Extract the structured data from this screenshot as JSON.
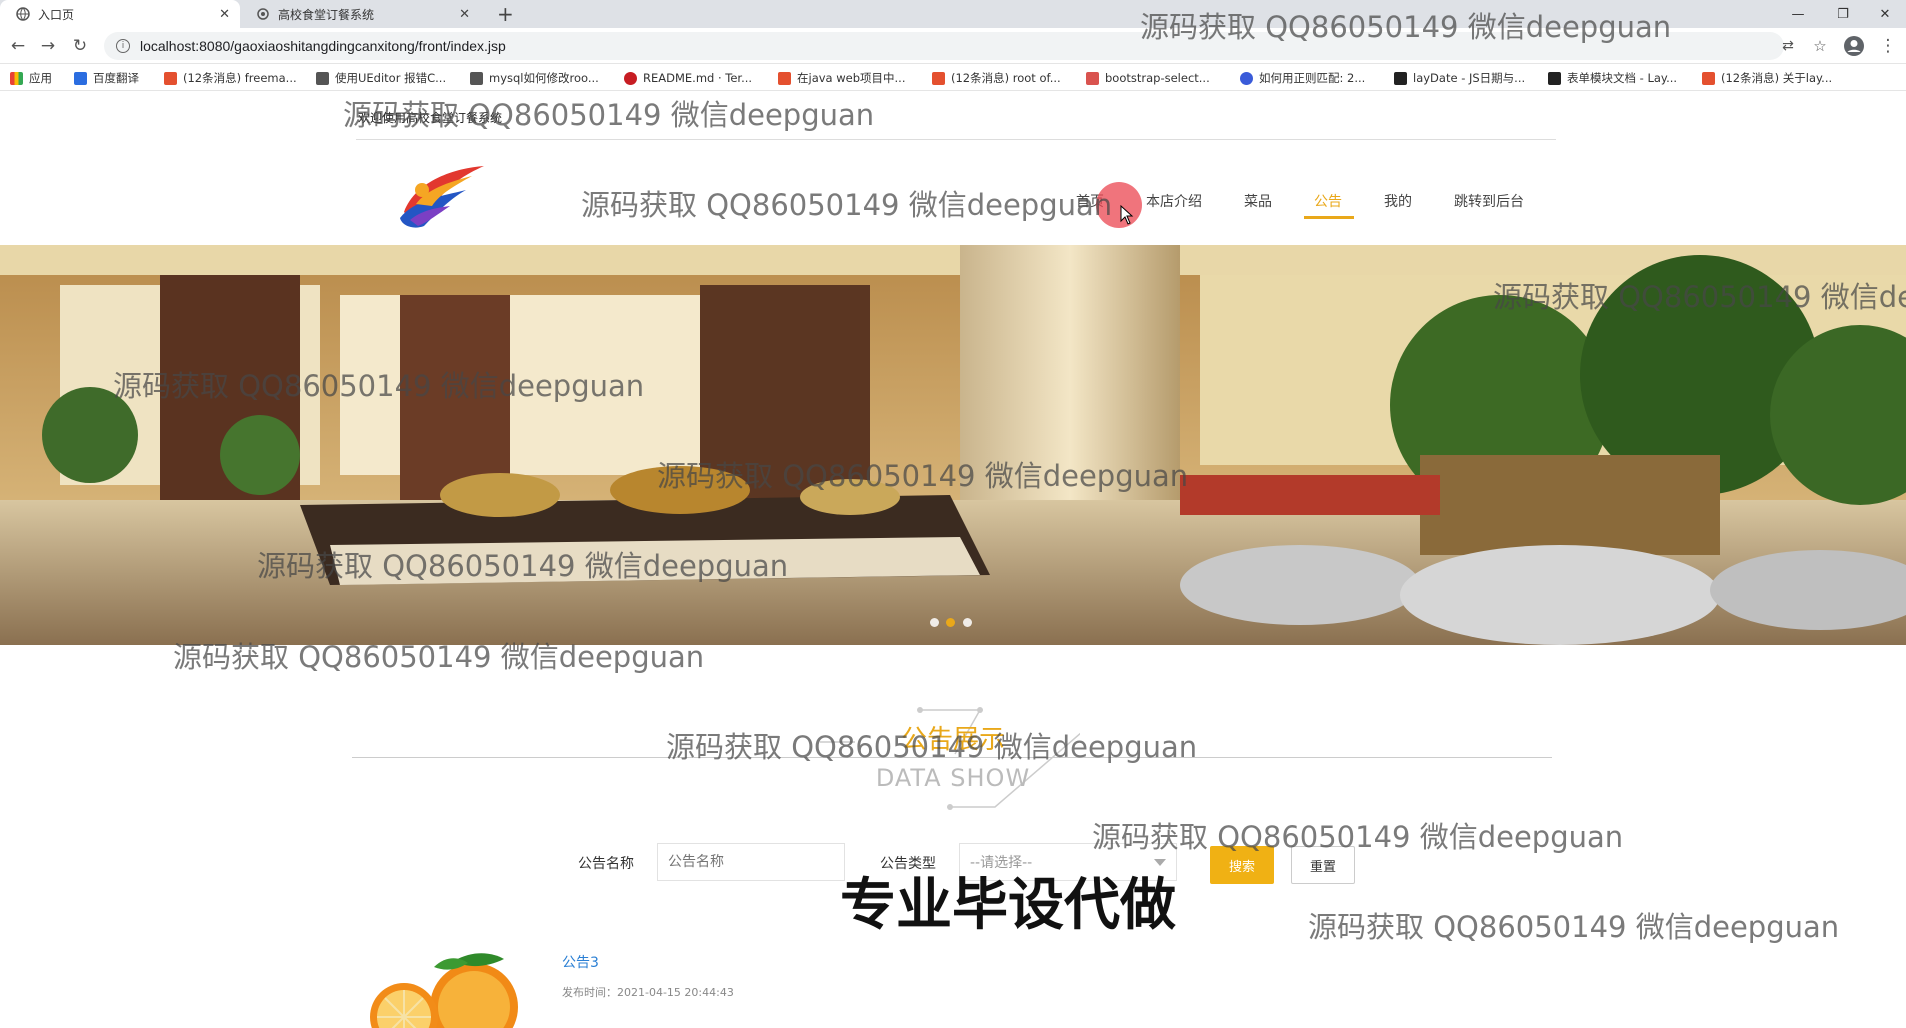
{
  "browser": {
    "tabs": [
      {
        "title": "入口页",
        "active": true
      },
      {
        "title": "高校食堂订餐系统",
        "active": false
      }
    ],
    "new_tab_label": "+",
    "url": "localhost:8080/gaoxiaoshitangdingcanxitong/front/index.jsp",
    "bookmarks": [
      "应用",
      "百度翻译",
      "(12条消息) freema...",
      "使用UEditor 报错C...",
      "mysql如何修改roo...",
      "README.md · Ter...",
      "在java web项目中...",
      "(12条消息) root of...",
      "bootstrap-select...",
      "如何用正则匹配: 2...",
      "layDate - JS日期与...",
      "表单模块文档 - Lay...",
      "(12条消息) 关于lay..."
    ]
  },
  "site": {
    "welcome": "欢迎使用高校食堂订餐系统",
    "nav": [
      {
        "label": "首页",
        "active": false
      },
      {
        "label": "本店介绍",
        "active": false
      },
      {
        "label": "菜品",
        "active": false
      },
      {
        "label": "公告",
        "active": true
      },
      {
        "label": "我的",
        "active": false
      },
      {
        "label": "跳转到后台",
        "active": false
      }
    ],
    "banner_dots": 3,
    "banner_active_dot": 2
  },
  "section": {
    "title": "公告展示",
    "subtitle": "DATA SHOW"
  },
  "filter": {
    "name_label": "公告名称",
    "name_placeholder": "公告名称",
    "type_label": "公告类型",
    "type_selected": "--请选择--",
    "search_label": "搜索",
    "reset_label": "重置"
  },
  "list": [
    {
      "title": "公告3",
      "date": "发布时间：2021-04-15 20:44:43"
    }
  ],
  "watermark": "源码获取 QQ86050149 微信deepguan",
  "overlay_text": "专业毕设代做",
  "colors": {
    "accent": "#e9a81a",
    "link": "#2a7fd4"
  }
}
